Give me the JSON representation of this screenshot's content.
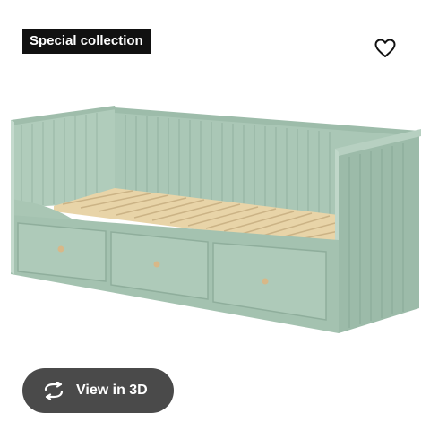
{
  "badge": {
    "label": "Special collection"
  },
  "favorite": {
    "icon": "heart-outline-icon"
  },
  "product_image": {
    "subject": "daybed-with-drawers",
    "color": "#a9c5b4"
  },
  "view_3d": {
    "label": "View in 3D",
    "icon": "rotate-arrows-icon"
  }
}
